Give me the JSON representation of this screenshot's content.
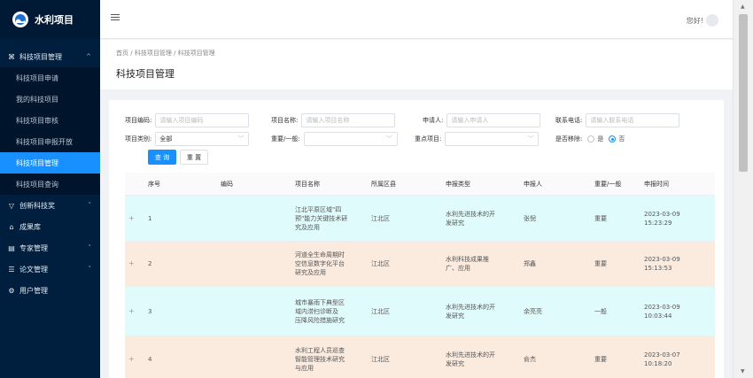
{
  "app": {
    "title": "水利项目"
  },
  "sidebar": {
    "groups": [
      {
        "label": "科技项目管理",
        "arrow": "^",
        "icon": "⌘"
      },
      {
        "label": "创新科技奖",
        "arrow": "˅",
        "icon": "▽"
      },
      {
        "label": "成果库",
        "icon": "⌂"
      },
      {
        "label": "专家管理",
        "arrow": "˅",
        "icon": "▤"
      },
      {
        "label": "论文管理",
        "arrow": "˅",
        "icon": "☰"
      },
      {
        "label": "用户管理",
        "icon": "⚙"
      }
    ],
    "sub_items": [
      "科技项目申请",
      "我的科技项目",
      "科技项目审核",
      "科技项目申报开放",
      "科技项目管理",
      "科技项目查询"
    ]
  },
  "header": {
    "greeting": "您好!"
  },
  "breadcrumb": {
    "home": "首页",
    "sep": "/",
    "level1": "科技项目管理",
    "level2": "科技项目管理"
  },
  "page_title": "科技项目管理",
  "form": {
    "project_code": {
      "label": "项目编码:",
      "placeholder": "请输入项目编码"
    },
    "project_name": {
      "label": "项目名称:",
      "placeholder": "请输入项目名称"
    },
    "applicant": {
      "label": "申请人:",
      "placeholder": "请输入申请人"
    },
    "phone": {
      "label": "联系电话:",
      "placeholder": "请输入联系电话"
    },
    "category": {
      "label": "项目类别:",
      "value": "全部"
    },
    "importance": {
      "label": "重要/一般:"
    },
    "key_project": {
      "label": "重点项目:"
    },
    "removed": {
      "label": "是否移除:",
      "opt_yes": "是",
      "opt_no": "否"
    },
    "query_btn": "查 询",
    "reset_btn": "重 置"
  },
  "table": {
    "headers": [
      "序号",
      "编码",
      "项目名称",
      "所属区县",
      "申报类型",
      "申报人",
      "重要/一般",
      "申报时间"
    ],
    "rows": [
      {
        "no": "1",
        "code": "",
        "name": [
          "江北平原区域\"四",
          "预\"能力关键技术研",
          "究及应用"
        ],
        "district": "江北区",
        "type": [
          "水利先进技术的开",
          "发研究"
        ],
        "applicant": "张倪",
        "level": "重要",
        "date": "2023-03-09",
        "time": "15:23:29"
      },
      {
        "no": "2",
        "code": "",
        "name": [
          "河道全生命周期时",
          "空信息数字化平台",
          "研究及应用"
        ],
        "district": "江北区",
        "type": [
          "水利科技成果推",
          "广、应用"
        ],
        "applicant": "郑鑫",
        "level": "重要",
        "date": "2023-03-09",
        "time": "15:13:53"
      },
      {
        "no": "3",
        "code": "",
        "name": [
          "城市暴雨下典型区",
          "域内涝扫诊断及",
          "压降风险措施研究"
        ],
        "district": "江北区",
        "type": [
          "水利先进技术的开",
          "发研究"
        ],
        "applicant": "余亮亮",
        "level": "一般",
        "date": "2023-03-09",
        "time": "10:03:44"
      },
      {
        "no": "4",
        "code": "",
        "name": [
          "水利工程人员巡查",
          "智能管理技术研究",
          "与应用"
        ],
        "district": "江北区",
        "type": [
          "水利先进技术的开",
          "发研究"
        ],
        "applicant": "俞杰",
        "level": "重要",
        "date": "2023-03-07",
        "time": "10:18:20"
      }
    ]
  }
}
